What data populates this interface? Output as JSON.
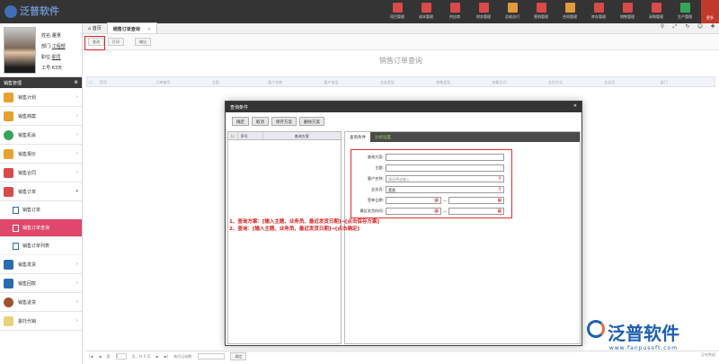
{
  "app": {
    "logo_text": "泛普软件"
  },
  "modules": [
    {
      "label": "项目管理",
      "icon": "project-icon"
    },
    {
      "label": "成本管理",
      "icon": "cost-icon"
    },
    {
      "label": "供应商",
      "icon": "supplier-icon"
    },
    {
      "label": "财务管理",
      "icon": "finance-icon"
    },
    {
      "label": "总收总付",
      "icon": "payment-icon"
    },
    {
      "label": "营销管理",
      "icon": "marketing-icon"
    },
    {
      "label": "合同管理",
      "icon": "contract-icon"
    },
    {
      "label": "库存管理",
      "icon": "inventory-icon"
    },
    {
      "label": "销售管理",
      "icon": "sales-icon"
    },
    {
      "label": "采购管理",
      "icon": "purchase-icon"
    },
    {
      "label": "生产管理",
      "icon": "production-icon"
    }
  ],
  "more_label": "更多",
  "profile": {
    "name_label": "姓名:",
    "name": "董惠",
    "dept_label": "部门:",
    "dept": "工程部",
    "role_label": "职位:",
    "role": "职员",
    "id_label": "工号:",
    "id": "63天"
  },
  "sidebar": {
    "section_title": "销售管理",
    "items": [
      {
        "label": "销售计划"
      },
      {
        "label": "销售档案"
      },
      {
        "label": "销售机会"
      },
      {
        "label": "销售报价"
      },
      {
        "label": "销售合同"
      },
      {
        "label": "销售订单"
      }
    ],
    "subitems": [
      {
        "label": "销售订单"
      },
      {
        "label": "销售订单查询"
      },
      {
        "label": "销售订单列表"
      }
    ],
    "items2": [
      {
        "label": "销售发货"
      },
      {
        "label": "销售回款"
      },
      {
        "label": "销售退货"
      },
      {
        "label": "委托代销"
      }
    ]
  },
  "tabs": {
    "home": "首页",
    "current": "销售订单查询"
  },
  "toolbar": {
    "query": "查询",
    "print": "打印",
    "export": "输出"
  },
  "page_title": "销售订单查询",
  "grid_columns": [
    "序号",
    "订单编号",
    "主题",
    "客户名称",
    "客户电话",
    "业务类型",
    "销售类型",
    "结算方式",
    "交付方式",
    "业务员",
    "部门"
  ],
  "dialog": {
    "title": "查询条件",
    "buttons": {
      "ok": "确定",
      "cancel": "取消",
      "save": "保存方案",
      "delete": "删除方案"
    },
    "left_headers": [
      "序号",
      "查询方案"
    ],
    "tabs": {
      "conditions": "查询条件",
      "grouping": "分组设置"
    },
    "fields": {
      "scheme_label": "查询方案:",
      "subject_label": "主题:",
      "customer_label": "客户名称:",
      "customer_placeholder": "请选择或输入",
      "salesman_label": "业务员:",
      "salesman_value": "董惠",
      "sign_date_label": "签单日期:",
      "delivery_label": "最近发货时间:",
      "dash": "—"
    }
  },
  "notes": {
    "line1": "1、查询方案：[输入主题、业务员、最近发货日期]→[点击保存方案]",
    "line2": "2、查询：[输入主题、业务员、最近发货日期]→[点击确定]"
  },
  "pager": {
    "first": "|◀",
    "prev": "◀",
    "page": "第",
    "page_value": "1",
    "of": "页，共 0 页",
    "next": "▶",
    "last": "▶|",
    "per_page": "每页记录数:",
    "confirm": "确定",
    "right": "没有数据"
  },
  "brand": {
    "cn": "泛普软件",
    "url": "www.fanpusoft.com"
  }
}
